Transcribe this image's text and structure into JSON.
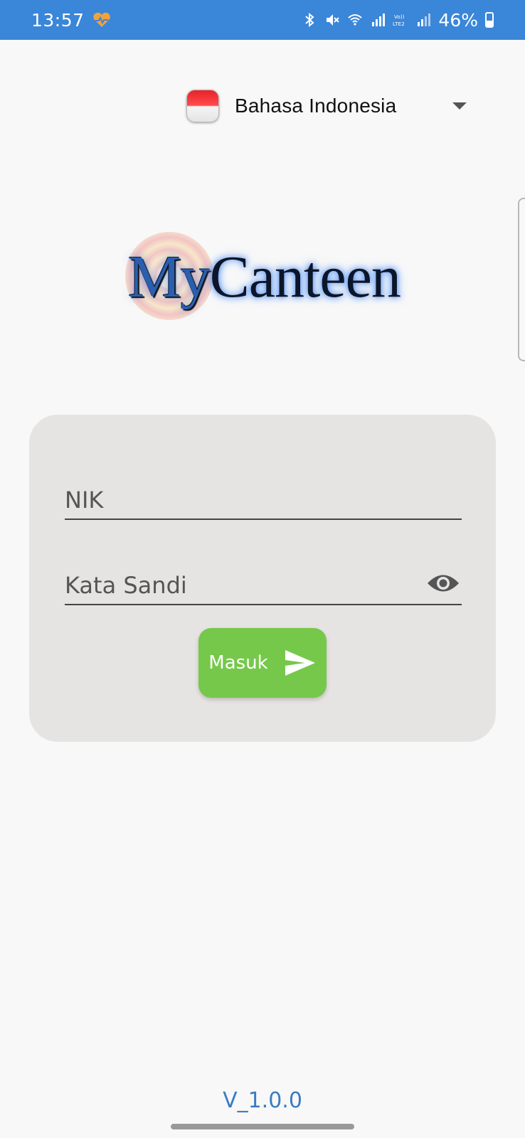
{
  "status_bar": {
    "time": "13:57",
    "battery": "46%",
    "icons": [
      "heart-activity-icon",
      "bluetooth-icon",
      "mute-icon",
      "wifi-icon",
      "signal-icon",
      "volte-lte2-icon",
      "signal-icon",
      "battery-icon"
    ],
    "background": "#3a86d9",
    "volte_line1": "Vo))",
    "volte_line2": "LTE2"
  },
  "language": {
    "label": "Bahasa Indonesia",
    "flag": "indonesia-flag-icon"
  },
  "logo": {
    "part1": "My",
    "part2": "Canteen"
  },
  "login": {
    "nik_placeholder": "NIK",
    "password_placeholder": "Kata Sandi",
    "submit_label": "Masuk",
    "submit_color": "#76c84b"
  },
  "footer": {
    "version": "V_1.0.0"
  }
}
